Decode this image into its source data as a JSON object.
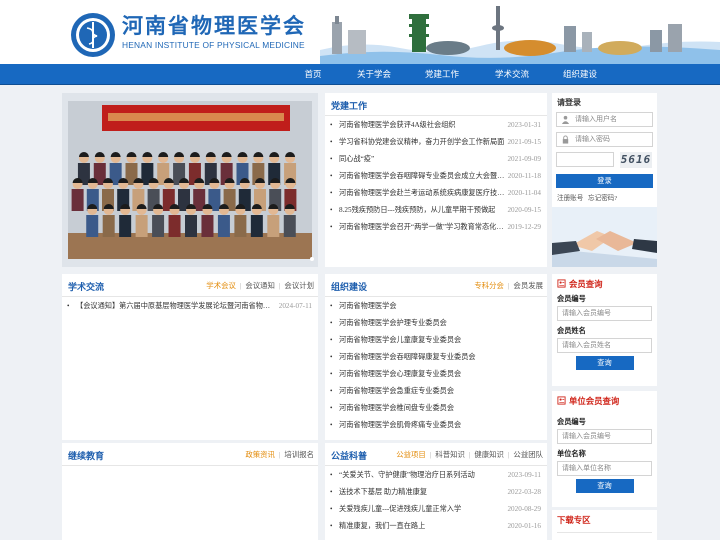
{
  "site": {
    "name_cn": "河南省物理医学会",
    "name_en": "HENAN INSTITUTE OF PHYSICAL MEDICINE"
  },
  "nav": [
    "首页",
    "关于学会",
    "党建工作",
    "学术交流",
    "组织建设"
  ],
  "party": {
    "title": "党建工作",
    "items": [
      {
        "title": "河南省物理医学会获评4A级社会组织",
        "date": "2023-01-31"
      },
      {
        "title": "学习省科协党建会议精神，奋力开创学会工作新局面",
        "date": "2021-09-15"
      },
      {
        "title": "同心战“疫”",
        "date": "2021-09-09"
      },
      {
        "title": "河南省物理医学会吞咽障碍专业委员会成立大会暨…",
        "date": "2020-11-18"
      },
      {
        "title": "河南省物理医学会赴兰考运动系统疾病康复医疗技…",
        "date": "2020-11-04"
      },
      {
        "title": "8.25残疾预防日---残疾预防，从儿童早期干预做起",
        "date": "2020-09-15"
      },
      {
        "title": "河南省物理医学会召开“两学一做”学习教育常态化…",
        "date": "2019-12-29"
      }
    ]
  },
  "login": {
    "title": "请登录",
    "username_placeholder": "请输入用户名",
    "password_placeholder": "请输入密码",
    "captcha": "5616",
    "button": "登录",
    "register": "注册账号",
    "forgot": "忘记密码?"
  },
  "academic": {
    "title": "学术交流",
    "links": [
      "学术会议",
      "会议通知",
      "会议计划"
    ],
    "items": [
      {
        "title": "【会议通知】第六届中原基层物理医学发展论坛暨河南省物理…",
        "date": "2024-07-11"
      }
    ]
  },
  "org": {
    "title": "组织建设",
    "links": [
      "专科分会",
      "会员发展"
    ],
    "items": [
      "河南省物理医学会",
      "河南省物理医学会护理专业委员会",
      "河南省物理医学会儿童康复专业委员会",
      "河南省物理医学会吞咽障碍康复专业委员会",
      "河南省物理医学会心理康复专业委员会",
      "河南省物理医学会急重症专业委员会",
      "河南省物理医学会椎间盘专业委员会",
      "河南省物理医学会肌骨疼痛专业委员会"
    ]
  },
  "member_query": {
    "title": "会员查询",
    "id_label": "会员编号",
    "id_placeholder": "请输入会员编号",
    "name_label": "会员姓名",
    "name_placeholder": "请输入会员姓名",
    "button": "查询"
  },
  "unit_query": {
    "title": "单位会员查询",
    "id_label": "会员编号",
    "id_placeholder": "请输入会员编号",
    "name_label": "单位名称",
    "name_placeholder": "请输入单位名称",
    "button": "查询"
  },
  "edu": {
    "title": "继续教育",
    "links": [
      "政策资讯",
      "培训报名"
    ]
  },
  "science": {
    "title": "公益科普",
    "links": [
      "公益项目",
      "科普知识",
      "健康知识",
      "公益团队"
    ],
    "items": [
      {
        "title": "“关爱关节、守护健康”物理治疗日系列活动",
        "date": "2023-09-11"
      },
      {
        "title": "送技术下基层 助力精准康复",
        "date": "2022-03-28"
      },
      {
        "title": "关爱残疾儿童---促进残疾儿童正常入学",
        "date": "2020-08-29"
      },
      {
        "title": "精准康复，我们一直在路上",
        "date": "2020-01-16"
      }
    ]
  },
  "download": {
    "title": "下载专区"
  },
  "colors": {
    "brand_blue": "#1769c2",
    "title_blue": "#1f5fae",
    "accent_orange": "#e38c0c",
    "accent_red": "#d0261b"
  }
}
